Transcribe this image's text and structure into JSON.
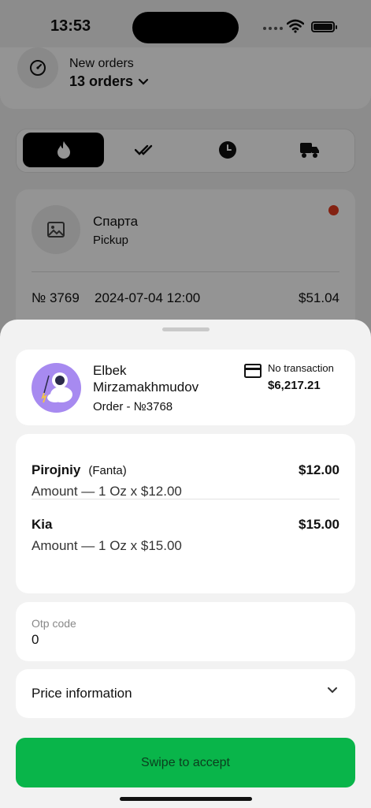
{
  "status_bar": {
    "time": "13:53"
  },
  "header": {
    "label": "New orders",
    "count": "13 orders"
  },
  "tabs": [
    {
      "name": "fire-icon",
      "active": true
    },
    {
      "name": "double-check-icon",
      "active": false
    },
    {
      "name": "clock-icon",
      "active": false
    },
    {
      "name": "delivery-truck-icon",
      "active": false
    }
  ],
  "order_card": {
    "store_name": "Спарта",
    "type": "Pickup",
    "number": "№ 3769",
    "datetime": "2024-07-04 12:00",
    "price": "$51.04"
  },
  "sheet": {
    "customer": {
      "name": "Elbek Mirzamakhmudov",
      "order": "Order - №3768",
      "transaction_label": "No transaction",
      "transaction_amount": "$6,217.21"
    },
    "items": [
      {
        "name": "Pirojniy",
        "modifier": "(Fanta)",
        "price": "$12.00",
        "amount": "Amount — 1 Oz x $12.00"
      },
      {
        "name": "Kia",
        "modifier": "",
        "price": "$15.00",
        "amount": "Amount — 1 Oz x $15.00"
      }
    ],
    "otp": {
      "label": "Otp code",
      "value": "0"
    },
    "price_info": {
      "label": "Price information"
    },
    "accept_button": "Swipe to accept"
  },
  "colors": {
    "accent_green": "#09b54a",
    "alert_red": "#e33b1f",
    "avatar_bg": "#a78af0"
  }
}
